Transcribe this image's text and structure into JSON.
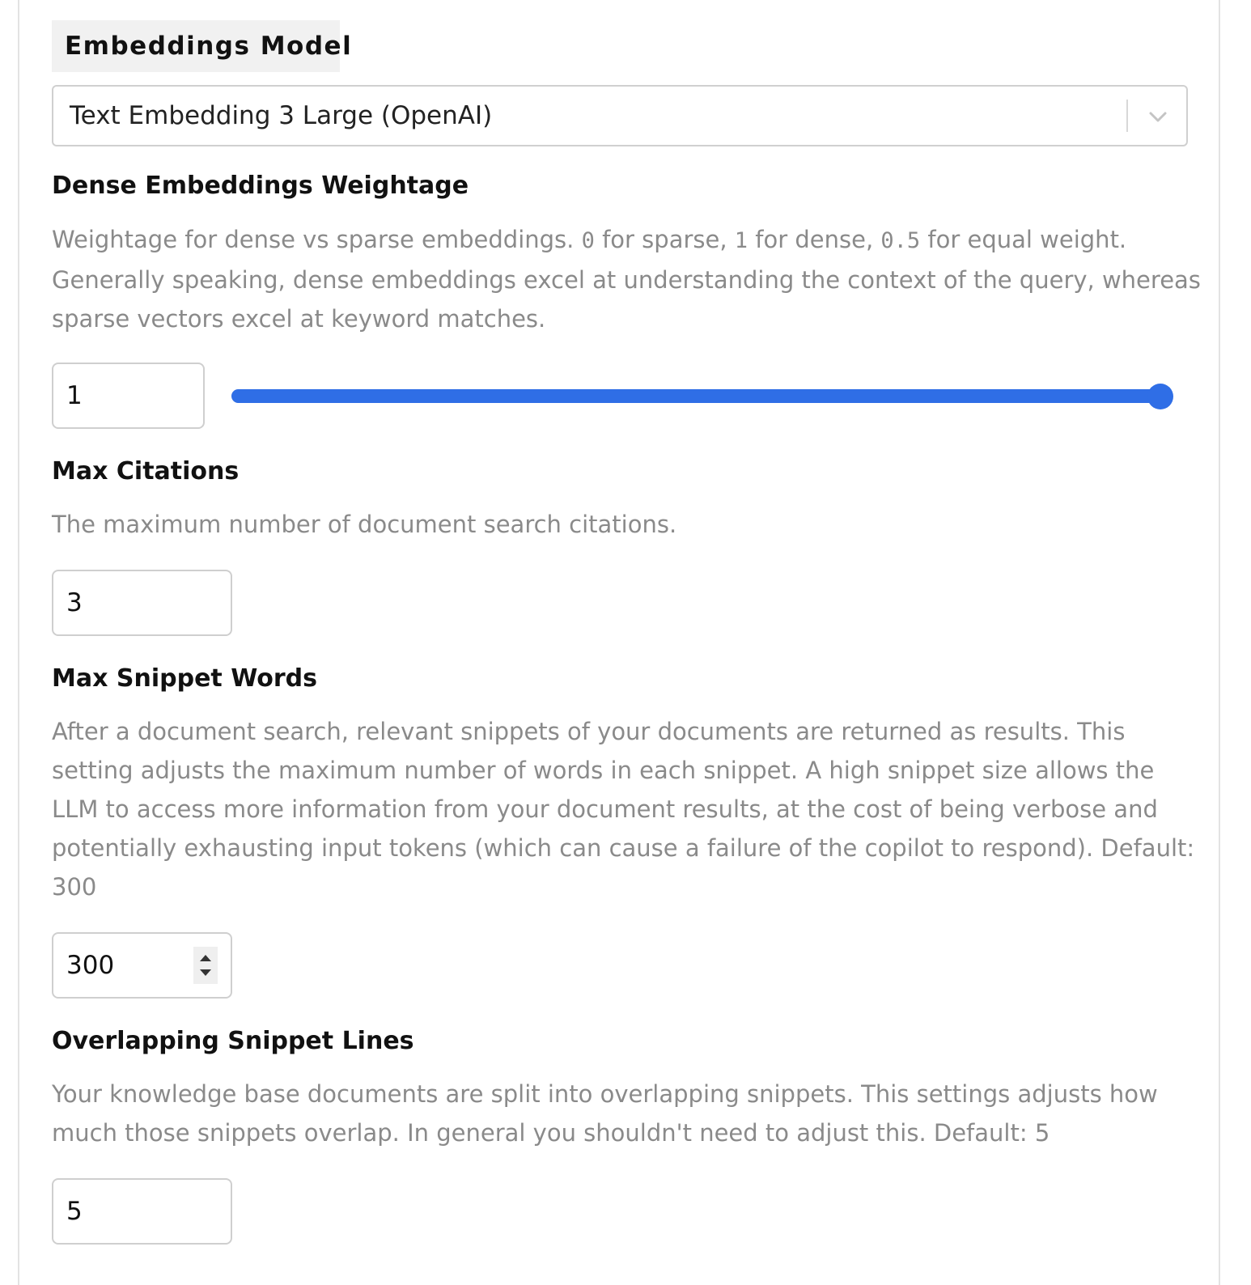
{
  "section": {
    "title": "Embeddings Model"
  },
  "embeddings_model": {
    "selected": "Text Embedding 3 Large (OpenAI)"
  },
  "dense_weightage": {
    "label": "Dense Embeddings Weightage",
    "desc_part1": "Weightage for dense vs sparse embeddings. ",
    "code_zero": "0",
    "desc_part2": " for sparse, ",
    "code_one": "1",
    "desc_part3": " for dense, ",
    "code_half": "0.5",
    "desc_part4": " for equal weight. Generally speaking, dense embeddings excel at understanding the context of the query, whereas sparse vectors excel at keyword matches.",
    "value": "1",
    "slider_fraction": 1,
    "accent_color": "#2f6ee6"
  },
  "max_citations": {
    "label": "Max Citations",
    "description": "The maximum number of document search citations.",
    "value": "3"
  },
  "max_snippet_words": {
    "label": "Max Snippet Words",
    "description": "After a document search, relevant snippets of your documents are returned as results. This setting adjusts the maximum number of words in each snippet. A high snippet size allows the LLM to access more information from your document results, at the cost of being verbose and potentially exhausting input tokens (which can cause a failure of the copilot to respond). Default: 300",
    "value": "300"
  },
  "overlapping_lines": {
    "label": "Overlapping Snippet Lines",
    "description": "Your knowledge base documents are split into overlapping snippets. This settings adjusts how much those snippets overlap. In general you shouldn't need to adjust this. Default: 5",
    "value": "5"
  }
}
